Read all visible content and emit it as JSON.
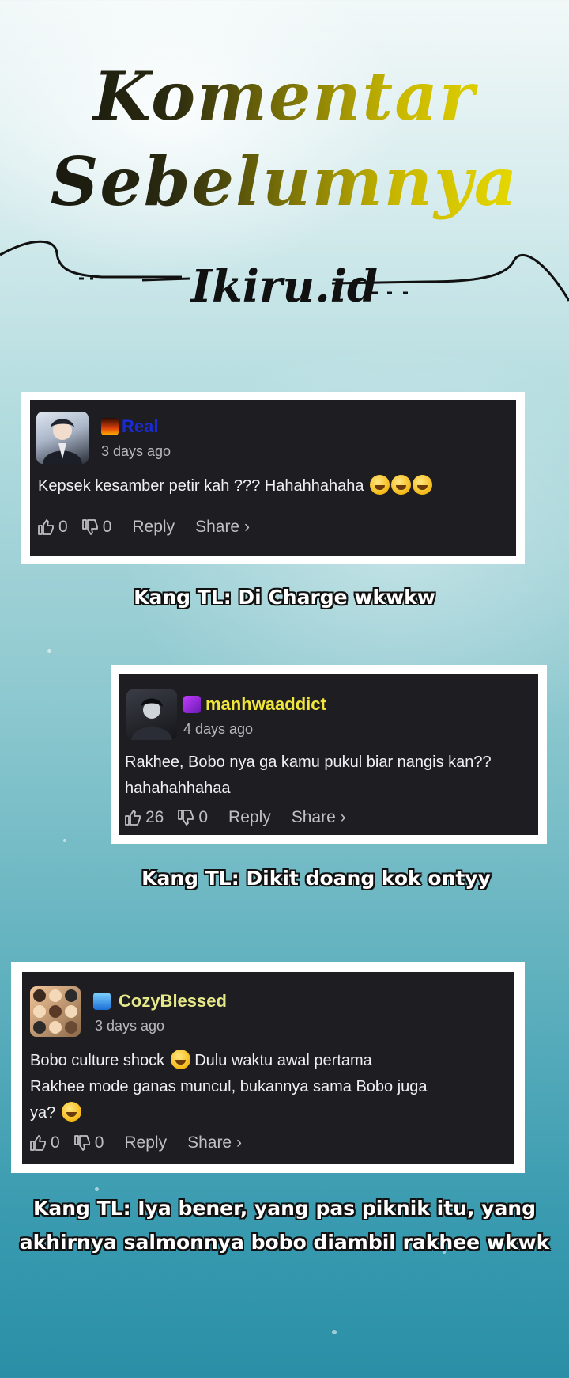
{
  "header": {
    "title_line1": "Komentar",
    "title_line2": "Sebelumnya",
    "brand": "Ikiru.id"
  },
  "comments": [
    {
      "username": "Real",
      "username_color": "#1a2bd6",
      "time": "3 days ago",
      "text": "Kepsek kesamber petir kah ??? Hahahhahaha",
      "emoji_count": 3,
      "likes": "0",
      "dislikes": "0",
      "reply_label": "Reply",
      "share_label": "Share ›",
      "caption": "Kang TL: Di Charge wkwkw"
    },
    {
      "username": "manhwaaddict",
      "username_color": "#f0e63a",
      "time": "4 days ago",
      "text_line1": "Rakhee, Bobo nya ga kamu pukul biar nangis kan??",
      "text_line2": "hahahahhahaa",
      "likes": "26",
      "dislikes": "0",
      "reply_label": "Reply",
      "share_label": "Share ›",
      "caption": "Kang TL: Dikit doang kok ontyy"
    },
    {
      "username": "CozyBlessed",
      "username_color": "#e6e88a",
      "time": "3 days ago",
      "text_line1": "Bobo culture shock",
      "text_line1b": "Dulu waktu awal pertama",
      "text_line2": "Rakhee mode ganas muncul, bukannya sama Bobo juga",
      "text_line3": "ya?",
      "likes": "0",
      "dislikes": "0",
      "reply_label": "Reply",
      "share_label": "Share ›",
      "caption_line1": "Kang TL: Iya bener, yang pas piknik itu, yang",
      "caption_line2": "akhirnya salmonnya bobo diambil rakhee wkwk"
    }
  ]
}
